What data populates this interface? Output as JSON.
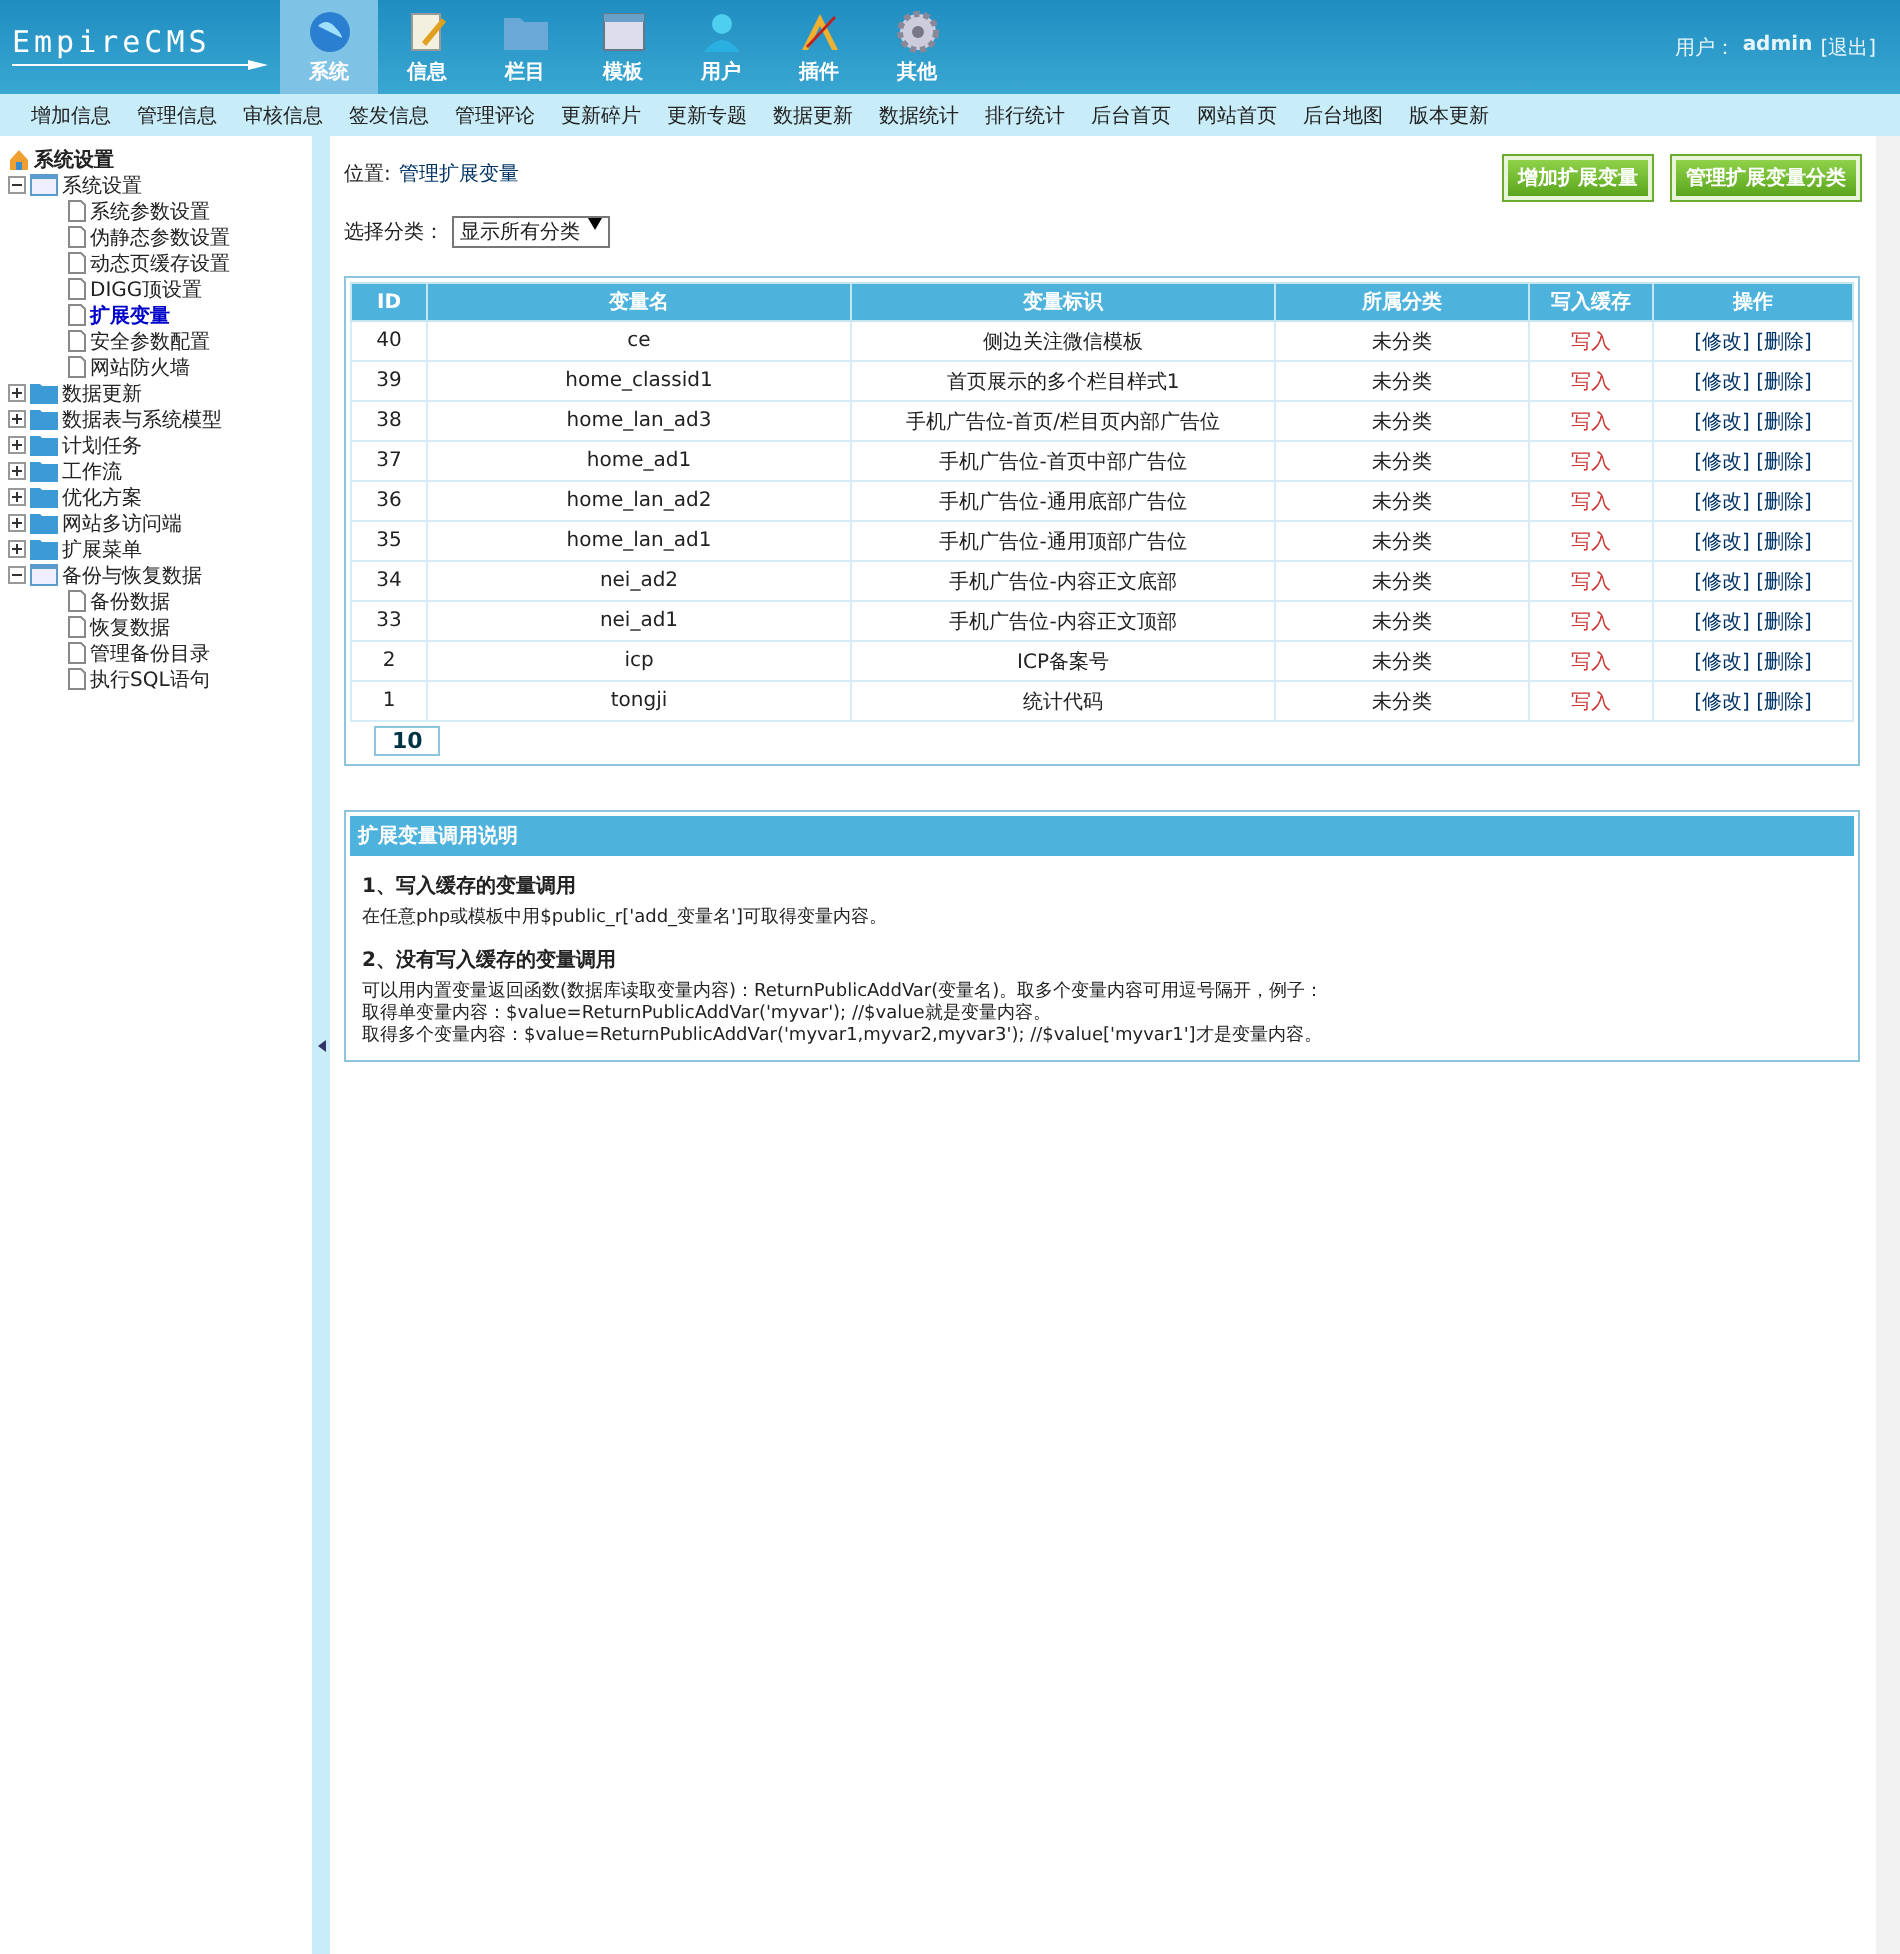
{
  "logo": "EmpireCMS",
  "nav_tabs": [
    {
      "label": "系统",
      "kind": "globe",
      "selected": true
    },
    {
      "label": "信息",
      "kind": "note",
      "selected": false
    },
    {
      "label": "栏目",
      "kind": "folder",
      "selected": false
    },
    {
      "label": "模板",
      "kind": "window",
      "selected": false
    },
    {
      "label": "用户",
      "kind": "user",
      "selected": false
    },
    {
      "label": "插件",
      "kind": "tools",
      "selected": false
    },
    {
      "label": "其他",
      "kind": "gear",
      "selected": false
    }
  ],
  "user": {
    "label": "用户：",
    "name": "admin",
    "logout": "[退出]"
  },
  "menu": [
    "增加信息",
    "管理信息",
    "审核信息",
    "签发信息",
    "管理评论",
    "更新碎片",
    "更新专题",
    "数据更新",
    "数据统计",
    "排行统计",
    "后台首页",
    "网站首页",
    "后台地图",
    "版本更新"
  ],
  "sidebar": {
    "title": "系统设置",
    "tree": [
      {
        "label": "系统设置",
        "expanded": true,
        "children": [
          {
            "label": "系统参数设置",
            "selected": false
          },
          {
            "label": "伪静态参数设置",
            "selected": false
          },
          {
            "label": "动态页缓存设置",
            "selected": false
          },
          {
            "label": "DIGG顶设置",
            "selected": false
          },
          {
            "label": "扩展变量",
            "selected": true
          },
          {
            "label": "安全参数配置",
            "selected": false
          },
          {
            "label": "网站防火墙",
            "selected": false
          }
        ]
      },
      {
        "label": "数据更新",
        "expanded": false
      },
      {
        "label": "数据表与系统模型",
        "expanded": false
      },
      {
        "label": "计划任务",
        "expanded": false
      },
      {
        "label": "工作流",
        "expanded": false
      },
      {
        "label": "优化方案",
        "expanded": false
      },
      {
        "label": "网站多访问端",
        "expanded": false
      },
      {
        "label": "扩展菜单",
        "expanded": false
      },
      {
        "label": "备份与恢复数据",
        "expanded": true,
        "children": [
          {
            "label": "备份数据",
            "selected": false
          },
          {
            "label": "恢复数据",
            "selected": false
          },
          {
            "label": "管理备份目录",
            "selected": false
          },
          {
            "label": "执行SQL语句",
            "selected": false
          }
        ]
      }
    ]
  },
  "breadcrumb": {
    "label": "位置:",
    "link": "管理扩展变量"
  },
  "buttons": [
    "增加扩展变量",
    "管理扩展变量分类"
  ],
  "filter": {
    "label": "选择分类：",
    "value": "显示所有分类"
  },
  "table": {
    "columns": [
      "ID",
      "变量名",
      "变量标识",
      "所属分类",
      "写入缓存",
      "操作"
    ],
    "rows": [
      {
        "cells": [
          "40",
          "ce",
          "侧边关注微信模板",
          "未分类",
          "写入"
        ],
        "actions": [
          "[修改]",
          "[删除]"
        ]
      },
      {
        "cells": [
          "39",
          "home_classid1",
          "首页展示的多个栏目样式1",
          "未分类",
          "写入"
        ],
        "actions": [
          "[修改]",
          "[删除]"
        ]
      },
      {
        "cells": [
          "38",
          "home_lan_ad3",
          "手机广告位-首页/栏目页内部广告位",
          "未分类",
          "写入"
        ],
        "actions": [
          "[修改]",
          "[删除]"
        ]
      },
      {
        "cells": [
          "37",
          "home_ad1",
          "手机广告位-首页中部广告位",
          "未分类",
          "写入"
        ],
        "actions": [
          "[修改]",
          "[删除]"
        ]
      },
      {
        "cells": [
          "36",
          "home_lan_ad2",
          "手机广告位-通用底部广告位",
          "未分类",
          "写入"
        ],
        "actions": [
          "[修改]",
          "[删除]"
        ]
      },
      {
        "cells": [
          "35",
          "home_lan_ad1",
          "手机广告位-通用顶部广告位",
          "未分类",
          "写入"
        ],
        "actions": [
          "[修改]",
          "[删除]"
        ]
      },
      {
        "cells": [
          "34",
          "nei_ad2",
          "手机广告位-内容正文底部",
          "未分类",
          "写入"
        ],
        "actions": [
          "[修改]",
          "[删除]"
        ]
      },
      {
        "cells": [
          "33",
          "nei_ad1",
          "手机广告位-内容正文顶部",
          "未分类",
          "写入"
        ],
        "actions": [
          "[修改]",
          "[删除]"
        ]
      },
      {
        "cells": [
          "2",
          "icp",
          "ICP备案号",
          "未分类",
          "写入"
        ],
        "actions": [
          "[修改]",
          "[删除]"
        ]
      },
      {
        "cells": [
          "1",
          "tongji",
          "统计代码",
          "未分类",
          "写入"
        ],
        "actions": [
          "[修改]",
          "[删除]"
        ]
      }
    ],
    "page": "10"
  },
  "help": {
    "title": "扩展变量调用说明",
    "sections": [
      {
        "heading": "1、写入缓存的变量调用",
        "lines": [
          "在任意php或模板中用$public_r['add_变量名']可取得变量内容。"
        ]
      },
      {
        "heading": "2、没有写入缓存的变量调用",
        "lines": [
          "可以用内置变量返回函数(数据库读取变量内容)：ReturnPublicAddVar(变量名)。取多个变量内容可用逗号隔开，例子：",
          "取得单变量内容：$value=ReturnPublicAddVar('myvar'); //$value就是变量内容。",
          "取得多个变量内容：$value=ReturnPublicAddVar('myvar1,myvar2,myvar3'); //$value['myvar1']才是变量内容。"
        ]
      }
    ]
  }
}
